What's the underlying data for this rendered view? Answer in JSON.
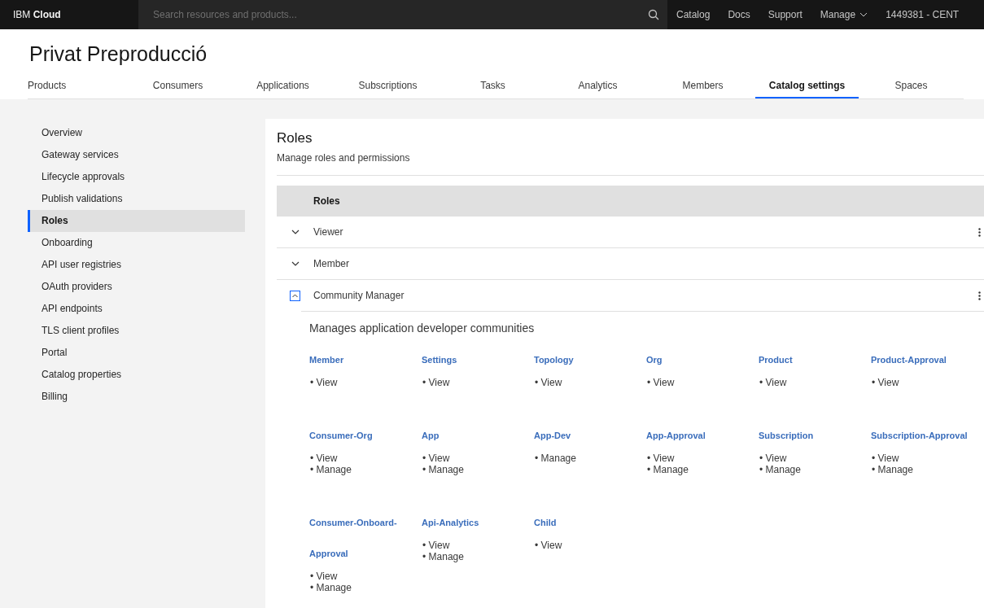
{
  "topbar": {
    "brand_prefix": "IBM",
    "brand_name": "Cloud",
    "search": {
      "placeholder": "Search resources and products..."
    },
    "links": [
      {
        "label": "Catalog",
        "kind": "link"
      },
      {
        "label": "Docs",
        "kind": "link"
      },
      {
        "label": "Support",
        "kind": "link"
      },
      {
        "label": "Manage",
        "kind": "menu"
      },
      {
        "label": "1449381 - CENT",
        "kind": "account"
      }
    ]
  },
  "page_title": "Privat Preproducció",
  "tabs": [
    {
      "label": "Products",
      "selected": false
    },
    {
      "label": "Consumers",
      "selected": false
    },
    {
      "label": "Applications",
      "selected": false
    },
    {
      "label": "Subscriptions",
      "selected": false
    },
    {
      "label": "Tasks",
      "selected": false
    },
    {
      "label": "Analytics",
      "selected": false
    },
    {
      "label": "Members",
      "selected": false
    },
    {
      "label": "Catalog settings",
      "selected": true
    },
    {
      "label": "Spaces",
      "selected": false
    }
  ],
  "sidebar": {
    "items": [
      {
        "label": "Overview",
        "selected": false
      },
      {
        "label": "Gateway services",
        "selected": false
      },
      {
        "label": "Lifecycle approvals",
        "selected": false
      },
      {
        "label": "Publish validations",
        "selected": false
      },
      {
        "label": "Roles",
        "selected": true
      },
      {
        "label": "Onboarding",
        "selected": false
      },
      {
        "label": "API user registries",
        "selected": false
      },
      {
        "label": "OAuth providers",
        "selected": false
      },
      {
        "label": "API endpoints",
        "selected": false
      },
      {
        "label": "TLS client profiles",
        "selected": false
      },
      {
        "label": "Portal",
        "selected": false
      },
      {
        "label": "Catalog properties",
        "selected": false
      },
      {
        "label": "Billing",
        "selected": false
      }
    ]
  },
  "section": {
    "title": "Roles",
    "subtitle": "Manage roles and permissions"
  },
  "table": {
    "column": "Roles",
    "rows": [
      {
        "name": "Viewer",
        "expanded": false,
        "menu": true
      },
      {
        "name": "Member",
        "expanded": false,
        "menu": false
      },
      {
        "name": "Community Manager",
        "expanded": true,
        "menu": true,
        "description": "Manages application developer communities",
        "permissions": [
          {
            "name": "Member",
            "actions": [
              "• View"
            ]
          },
          {
            "name": "Settings",
            "actions": [
              "• View"
            ]
          },
          {
            "name": "Topology",
            "actions": [
              "• View"
            ]
          },
          {
            "name": "Org",
            "actions": [
              "• View"
            ]
          },
          {
            "name": "Product",
            "actions": [
              "• View"
            ]
          },
          {
            "name": "Product-Approval",
            "actions": [
              "• View"
            ]
          },
          {
            "name": "Consumer-Org",
            "actions": [
              "• View",
              "• Manage"
            ]
          },
          {
            "name": "App",
            "actions": [
              "• View",
              "• Manage"
            ]
          },
          {
            "name": "App-Dev",
            "actions": [
              "• Manage"
            ]
          },
          {
            "name": "App-Approval",
            "actions": [
              "• View",
              "• Manage"
            ]
          },
          {
            "name": "Subscription",
            "actions": [
              "• View",
              "• Manage"
            ]
          },
          {
            "name": "Subscription-Approval",
            "actions": [
              "• View",
              "• Manage"
            ]
          },
          {
            "name": "Consumer-Onboard-Approval",
            "actions": [
              "• View",
              "• Manage"
            ]
          },
          {
            "name": "Api-Analytics",
            "actions": [
              "• View",
              "• Manage"
            ]
          },
          {
            "name": "Child",
            "actions": [
              "• View"
            ]
          }
        ]
      }
    ]
  }
}
